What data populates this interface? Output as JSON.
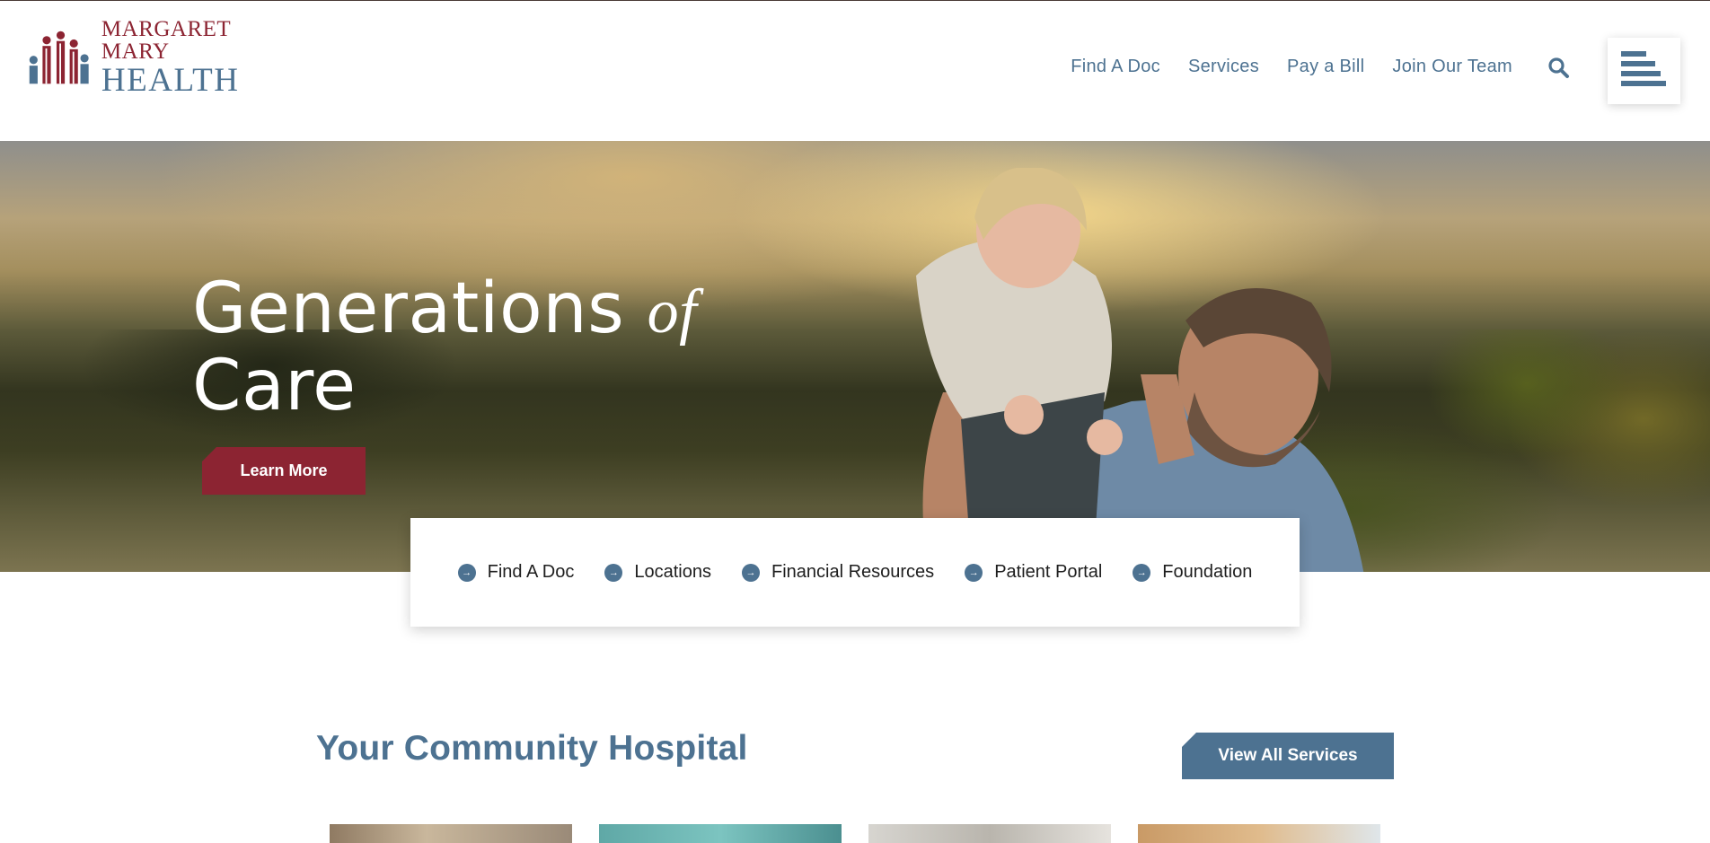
{
  "brand": {
    "name_line1": "MARGARET MARY",
    "name_line2": "HEALTH",
    "colors": {
      "primary_red": "#8c2432",
      "primary_blue": "#4d7291"
    }
  },
  "header": {
    "nav": [
      {
        "label": "Find A Doc"
      },
      {
        "label": "Services"
      },
      {
        "label": "Pay a Bill"
      },
      {
        "label": "Join Our Team"
      }
    ],
    "search_icon": "search-icon",
    "menu_icon": "hamburger-menu-icon"
  },
  "hero": {
    "heading_line1": "Generations",
    "heading_of": "of",
    "heading_line2": "Care",
    "cta_label": "Learn More"
  },
  "quick_links": [
    {
      "label": "Find A Doc",
      "icon": "arrow-circle-icon"
    },
    {
      "label": "Locations",
      "icon": "arrow-circle-icon"
    },
    {
      "label": "Financial Resources",
      "icon": "arrow-circle-icon"
    },
    {
      "label": "Patient Portal",
      "icon": "arrow-circle-icon"
    },
    {
      "label": "Foundation",
      "icon": "arrow-circle-icon"
    }
  ],
  "community": {
    "title": "Your Community Hospital",
    "view_all_label": "View All Services"
  }
}
